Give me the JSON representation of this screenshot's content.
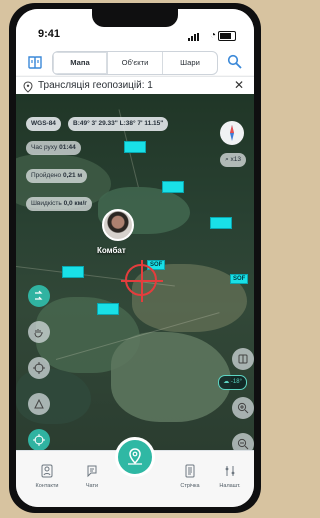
{
  "status": {
    "time": "9:41"
  },
  "tabs": [
    {
      "label": "Мапа",
      "active": true
    },
    {
      "label": "Об'єкти",
      "active": false
    },
    {
      "label": "Шари",
      "active": false
    }
  ],
  "broadcast": {
    "text": "Трансляція геопозицій: 1"
  },
  "map": {
    "coords_label": "WGS-84",
    "coords_value": "B:49° 3' 29.33\" L:38° 7' 11.15\"",
    "time_label": "Час руху",
    "time_value": "01:44",
    "distance_label": "Пройдено",
    "distance_value": "0,21 м",
    "speed_label": "Швидкість",
    "speed_value": "0,0 км/г",
    "zoom_label": "x13",
    "avatar_label": "Комбат",
    "sof_labels": [
      "SOF",
      "SOF"
    ],
    "temperature": "-18°"
  },
  "bottom_nav": [
    {
      "label": "Контакти"
    },
    {
      "label": "Чати"
    },
    {
      "label": "Стрічка"
    },
    {
      "label": "Налашт."
    }
  ],
  "colors": {
    "accent": "#2fb8a4",
    "marker": "#19e0e7",
    "target": "#e43d3d"
  }
}
